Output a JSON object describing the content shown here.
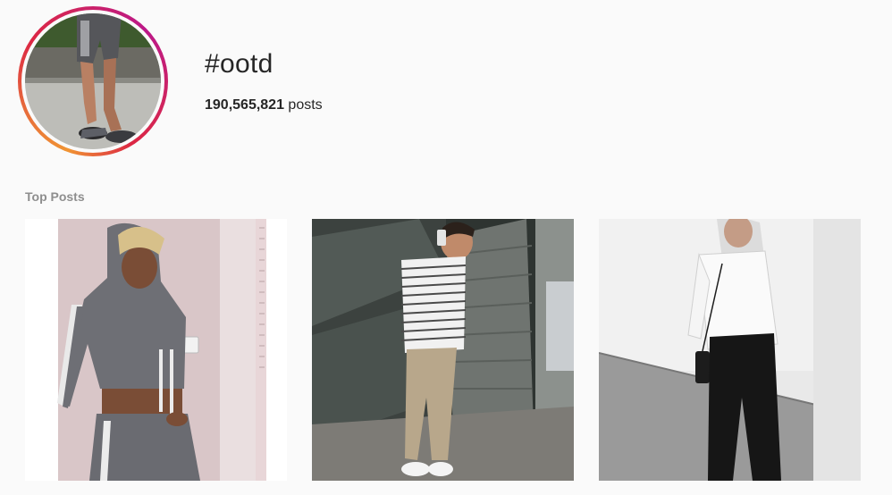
{
  "hashtag": {
    "title": "#ootd",
    "post_count": "190,565,821",
    "post_count_suffix": " posts"
  },
  "sections": {
    "top_posts_label": "Top Posts"
  },
  "colors": {
    "ring_gradient": [
      "#f09433",
      "#e6683c",
      "#dc2743",
      "#cc2366",
      "#bc1888"
    ],
    "muted_label": "#8e8e8e",
    "background": "#fafafa"
  },
  "posts": [
    {
      "name": "top-post-1",
      "subject": "woman in grey hooded crop top and leggings"
    },
    {
      "name": "top-post-2",
      "subject": "man in striped tee on phone, architecture background"
    },
    {
      "name": "top-post-3",
      "subject": "woman in white shirt and black trousers against white wall"
    }
  ]
}
